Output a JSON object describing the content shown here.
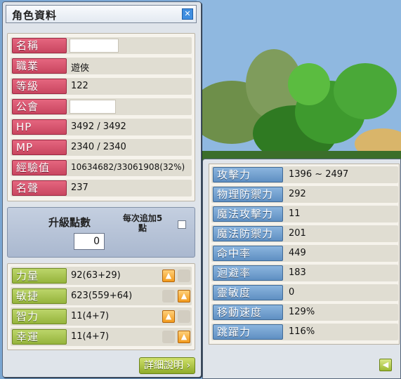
{
  "window": {
    "title": "角色資料",
    "close_icon": "close-icon"
  },
  "info": {
    "rows": [
      {
        "label": "名稱",
        "value": ""
      },
      {
        "label": "職業",
        "value": "遊俠"
      },
      {
        "label": "等級",
        "value": "122"
      },
      {
        "label": "公會",
        "value": ""
      },
      {
        "label": "HP",
        "value": "3492 / 3492"
      },
      {
        "label": "MP",
        "value": "2340 / 2340"
      },
      {
        "label": "經驗值",
        "value": "10634682/33061908(32%)"
      },
      {
        "label": "名聲",
        "value": "237"
      }
    ]
  },
  "ability_points": {
    "label": "升級點數",
    "value": "0",
    "auto_assign_label_line1": "每次追加5",
    "auto_assign_label_line2": "點",
    "auto_assign_checked": false
  },
  "stats": {
    "rows": [
      {
        "label": "力量",
        "value": "92(63+29)"
      },
      {
        "label": "敏捷",
        "value": "623(559+64)"
      },
      {
        "label": "智力",
        "value": "11(4+7)"
      },
      {
        "label": "幸運",
        "value": "11(4+7)"
      }
    ],
    "up_icon": "arrow-up-icon"
  },
  "detail_button": {
    "label": "詳細說明",
    "icon": "chevron-right-icon"
  },
  "detail": {
    "rows": [
      {
        "label": "攻擊力",
        "value": "1396 ~ 2497"
      },
      {
        "label": "物理防禦力",
        "value": "292"
      },
      {
        "label": "魔法攻擊力",
        "value": "11"
      },
      {
        "label": "魔法防禦力",
        "value": "201"
      },
      {
        "label": "命中率",
        "value": "449"
      },
      {
        "label": "迴避率",
        "value": "183"
      },
      {
        "label": "靈敏度",
        "value": "0"
      },
      {
        "label": "移動速度",
        "value": "129%"
      },
      {
        "label": "跳躍力",
        "value": "116%"
      }
    ],
    "back_icon": "arrow-left-icon"
  },
  "colors": {
    "info_label": "#d9506c",
    "stat_label": "#a8c44c",
    "detail_label": "#6f9ccf",
    "sky": "#6f9cc6",
    "foliage": "#3f8a2a"
  }
}
